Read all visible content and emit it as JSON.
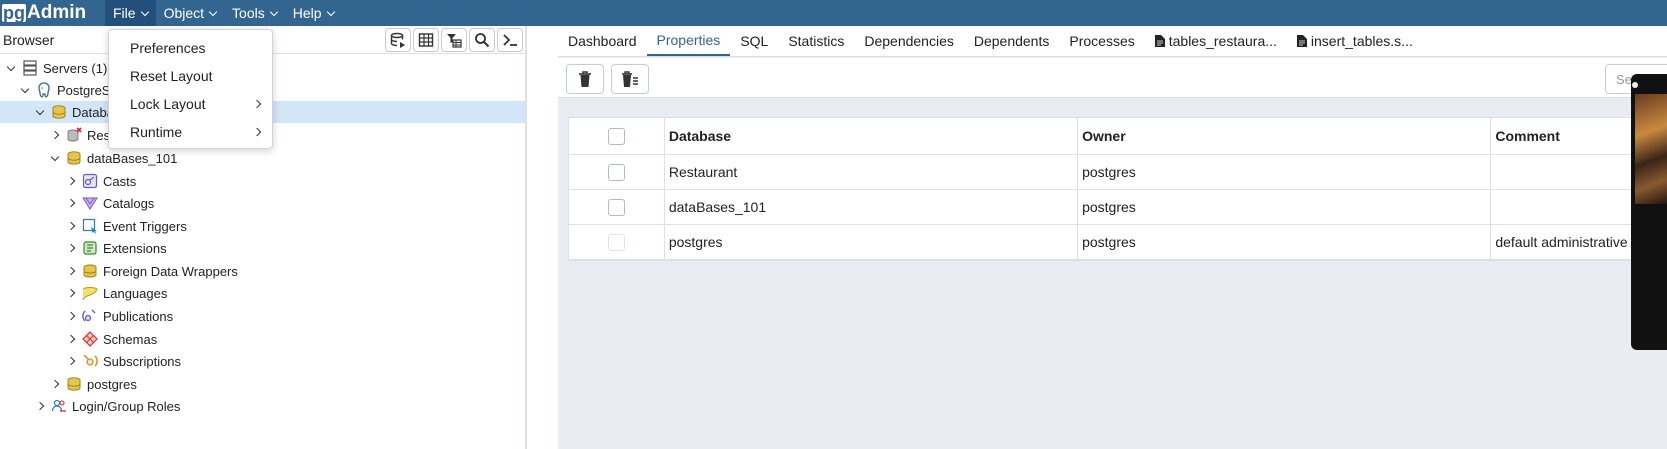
{
  "app": {
    "logo_pg": "pg",
    "logo_admin": "Admin"
  },
  "menubar": {
    "items": [
      "File",
      "Object",
      "Tools",
      "Help"
    ]
  },
  "file_menu": {
    "items": [
      {
        "label": "Preferences",
        "submenu": false
      },
      {
        "label": "Reset Layout",
        "submenu": false
      },
      {
        "label": "Lock Layout",
        "submenu": true
      },
      {
        "label": "Runtime",
        "submenu": true
      }
    ]
  },
  "browser": {
    "title": "Browser",
    "toolbar_icons": [
      "query-tool-icon",
      "view-data-icon",
      "filtered-rows-icon",
      "search-objects-icon",
      "psql-tool-icon"
    ],
    "tree": [
      {
        "label": "Servers (1)",
        "icon": "servers-icon",
        "expanded": true
      },
      {
        "label": "PostgreS",
        "icon": "postgres-elephant-icon",
        "expanded": true
      },
      {
        "label": "Databa",
        "icon": "databases-icon",
        "expanded": true,
        "selected": true
      },
      {
        "label": "Rest",
        "icon": "database-disconnected-icon",
        "expanded": false
      },
      {
        "label": "dataBases_101",
        "icon": "database-icon",
        "expanded": true
      },
      {
        "label": "Casts",
        "icon": "casts-icon",
        "expanded": false
      },
      {
        "label": "Catalogs",
        "icon": "catalogs-icon",
        "expanded": false
      },
      {
        "label": "Event Triggers",
        "icon": "event-triggers-icon",
        "expanded": false
      },
      {
        "label": "Extensions",
        "icon": "extensions-icon",
        "expanded": false
      },
      {
        "label": "Foreign Data Wrappers",
        "icon": "foreign-data-wrappers-icon",
        "expanded": false
      },
      {
        "label": "Languages",
        "icon": "languages-icon",
        "expanded": false
      },
      {
        "label": "Publications",
        "icon": "publications-icon",
        "expanded": false
      },
      {
        "label": "Schemas",
        "icon": "schemas-icon",
        "expanded": false
      },
      {
        "label": "Subscriptions",
        "icon": "subscriptions-icon",
        "expanded": false
      },
      {
        "label": "postgres",
        "icon": "database-icon",
        "expanded": false
      },
      {
        "label": "Login/Group Roles",
        "icon": "login-roles-icon",
        "expanded": false
      }
    ]
  },
  "tabs": {
    "items": [
      {
        "label": "Dashboard",
        "active": false,
        "file": false
      },
      {
        "label": "Properties",
        "active": true,
        "file": false
      },
      {
        "label": "SQL",
        "active": false,
        "file": false
      },
      {
        "label": "Statistics",
        "active": false,
        "file": false
      },
      {
        "label": "Dependencies",
        "active": false,
        "file": false
      },
      {
        "label": "Dependents",
        "active": false,
        "file": false
      },
      {
        "label": "Processes",
        "active": false,
        "file": false
      },
      {
        "label": "tables_restaura...",
        "active": false,
        "file": true
      },
      {
        "label": "insert_tables.s...",
        "active": false,
        "file": true
      }
    ]
  },
  "properties": {
    "search_placeholder": "Se",
    "columns": [
      "Database",
      "Owner",
      "Comment"
    ],
    "rows": [
      {
        "database": "Restaurant",
        "owner": "postgres",
        "comment": ""
      },
      {
        "database": "dataBases_101",
        "owner": "postgres",
        "comment": ""
      },
      {
        "database": "postgres",
        "owner": "postgres",
        "comment": "default administrative"
      }
    ]
  },
  "colors": {
    "topbar": "#326690",
    "selected_row": "#d3e6f7",
    "accent": "#326690"
  }
}
